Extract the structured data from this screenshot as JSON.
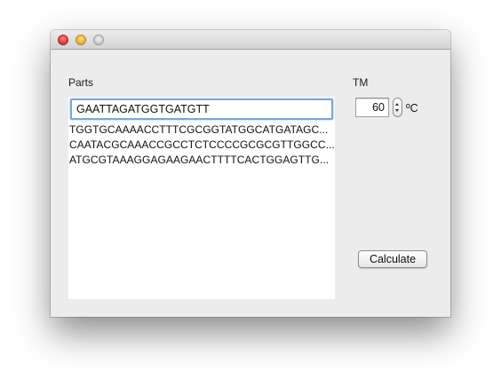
{
  "window": {
    "controls": [
      "close",
      "minimize",
      "zoom"
    ]
  },
  "parts": {
    "label": "Parts",
    "input_value": "GAATTAGATGGTGATGTT",
    "rows": [
      "TGGTGCAAAACCTTTCGCGGTATGGCATGATAGC...",
      "CAATACGCAAACCGCCTCTCCCCGCGCGTTGGCC...",
      "ATGCGTAAAGGAGAAGAACTTTTCACTGGAGTTG..."
    ]
  },
  "tm": {
    "label": "TM",
    "value": "60",
    "unit": "ºC"
  },
  "actions": {
    "calculate_label": "Calculate"
  },
  "colors": {
    "focus_ring": "#7aa7d6",
    "window_bg": "#ececec"
  }
}
